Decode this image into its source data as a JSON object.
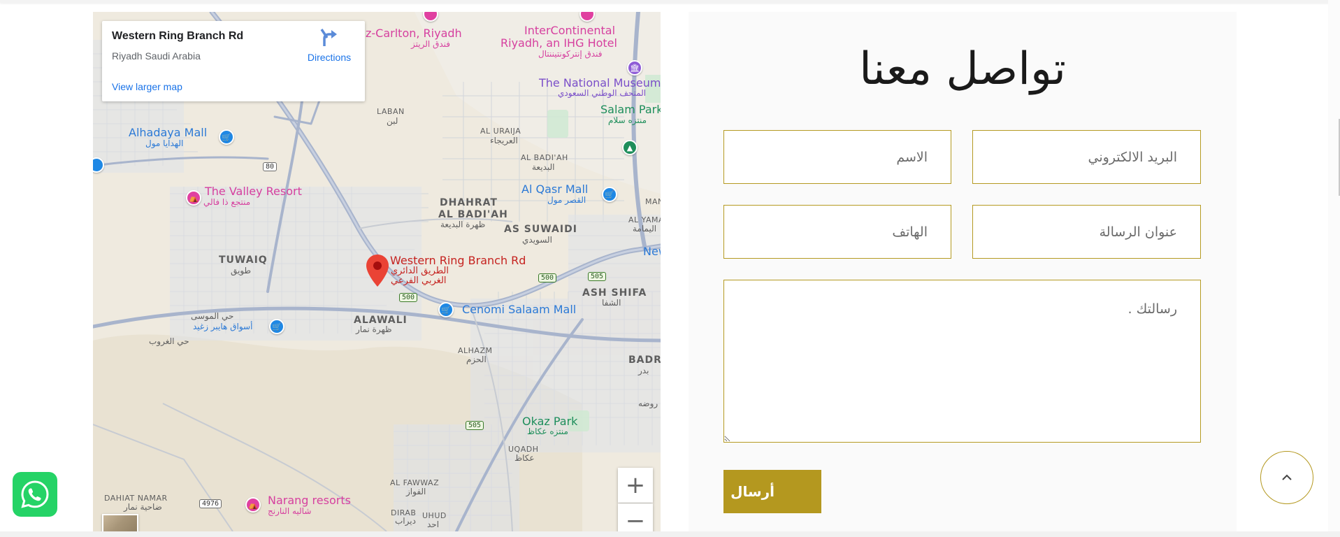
{
  "map": {
    "info_card": {
      "title": "Western Ring Branch Rd",
      "subtitle": "Riyadh Saudi Arabia",
      "directions_label": "Directions",
      "view_larger_label": "View larger map"
    },
    "labels": {
      "ritz": "z-Carlton, Riyadh",
      "ritz_ar": "فندق الريتز",
      "intercon_1": "InterContinental",
      "intercon_2": "Riyadh, an IHG Hotel",
      "intercon_ar": "فندق إنتركونتيننتال",
      "museum": "The National Museum",
      "museum_ar": "المتحف الوطني السعودي",
      "salam_park": "Salam Park",
      "salam_park_ar": "منتزه سلام",
      "laban": "LABAN",
      "laban_ar": "لبن",
      "al_uraija": "AL URAIJA",
      "al_uraija_ar": "العريجاء",
      "alhadaya": "Alhadaya Mall",
      "alhadaya_ar": "الهدايا مول",
      "al_badiah": "AL BADI'AH",
      "al_badiah_ar": "البديعة",
      "al_qasr": "Al Qasr Mall",
      "al_qasr_ar": "القصر مول",
      "valley": "The Valley Resort",
      "valley_ar": "منتجع ذا فالي",
      "dhahrat_1": "DHAHRAT",
      "dhahrat_2": "AL BADI'AH",
      "dhahrat_ar": "ظهرة البديعة",
      "as_suwaidi": "AS SUWAIDI",
      "as_suwaidi_ar": "السويدي",
      "man": "MAN",
      "al_yamamah": "AL YAMAM",
      "al_yamamah_ar": "اليمامة",
      "new": "New",
      "tuwaiq": "TUWAIQ",
      "tuwaiq_ar": "طويق",
      "pin_label": "Western Ring Branch Rd",
      "pin_label_ar_1": "الطريق الدائري",
      "pin_label_ar_2": "الغربي الفرعي",
      "ash_shifa": "ASH SHIFA",
      "ash_shifa_ar": "الشفا",
      "mosa": "حي الموسى",
      "hyper": "أسواق هايبر زغيد",
      "ghrob": "حي الغروب",
      "alawali": "ALAWALI",
      "alawali_ar": "ظهرة نمار",
      "cenomi": "Cenomi Salaam Mall",
      "alhazm": "ALHAZM",
      "alhazm_ar": "الحزم",
      "badr": "BADR",
      "badr_ar": "بدر",
      "okaz": "Okaz Park",
      "okaz_ar": "منتزه عكاظ",
      "rawshah_ar": "روضه",
      "uqadh": "UQADH",
      "uqadh_ar": "عكاظ",
      "dahiat_1": "DAHIAT NAMAR",
      "dahiat_ar": "ضاحية نمار",
      "narang": "Narang resorts",
      "narang_ar": "شاليه النارنج",
      "al_fawwaz": "AL FAWWAZ",
      "al_fawwaz_ar": "الفواز",
      "dirab": "DIRAB",
      "dirab_ar": "ديراب",
      "uhud": "UHUD",
      "uhud_ar": "احد"
    },
    "shields": {
      "r80": "80",
      "r500a": "500",
      "r500b": "500",
      "r505a": "505",
      "r505b": "505",
      "r4976": "4976"
    },
    "zoom_in": "+",
    "zoom_out": "−"
  },
  "form": {
    "title": "تواصل معنا",
    "name_placeholder": "الاسم",
    "email_placeholder": "البريد الالكتروني",
    "phone_placeholder": "الهاتف",
    "subject_placeholder": "عنوان الرسالة",
    "message_placeholder": "رسالتك .",
    "submit_label": "أرسال"
  },
  "colors": {
    "accent": "#b4981f",
    "whatsapp": "#25d366",
    "map_link": "#1a73e8"
  }
}
